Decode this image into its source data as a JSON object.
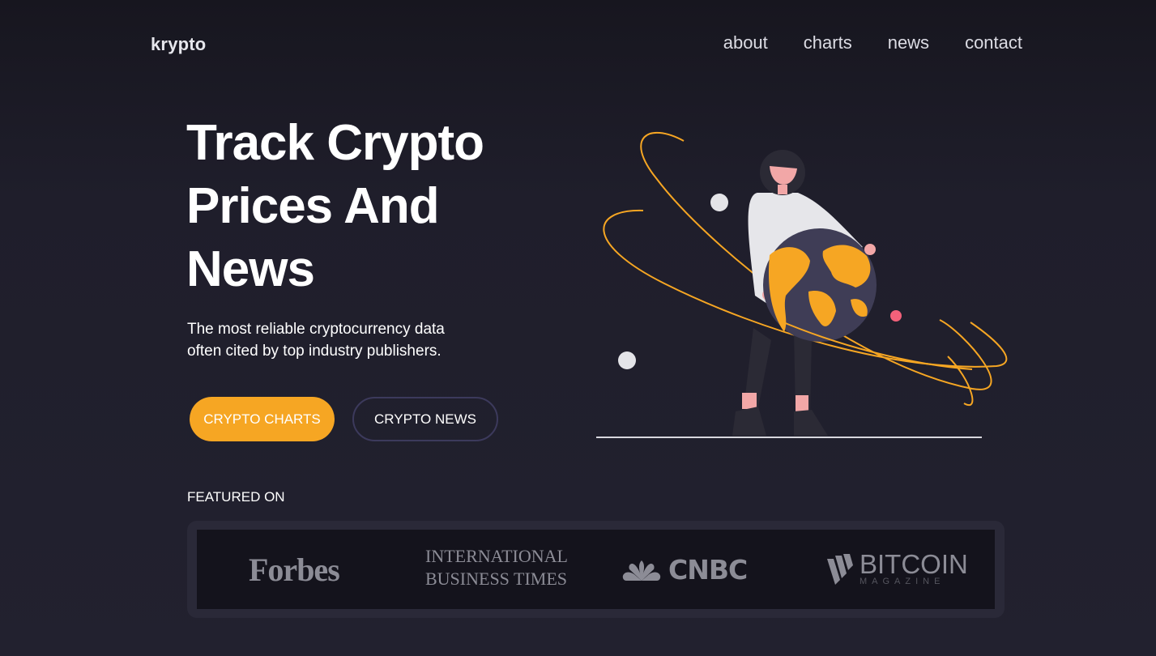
{
  "nav": {
    "logo": "krypto",
    "links": [
      "about",
      "charts",
      "news",
      "contact"
    ]
  },
  "hero": {
    "title_lines": [
      "Track Crypto",
      "Prices And",
      "News"
    ],
    "subtitle_lines": [
      "The most reliable cryptocurrency data",
      "often cited by top industry publishers."
    ],
    "buttons": {
      "primary": "CRYPTO CHARTS",
      "secondary": "CRYPTO NEWS"
    }
  },
  "featured": {
    "label": "FEATURED ON",
    "logos": {
      "forbes": "Forbes",
      "ibt_lines": [
        "International",
        "Business Times"
      ],
      "cnbc": "CNBC",
      "bitcoin_main": "BITCOIN",
      "bitcoin_sub": "MAGAZINE"
    }
  },
  "colors": {
    "accent": "#f6a623",
    "background": "#1f1e2b",
    "logo_strip": "#14131c",
    "pink": "#f2617a"
  },
  "illustration": {
    "icons": [
      "woman-figure-icon",
      "globe-icon",
      "orbit-icon"
    ]
  }
}
